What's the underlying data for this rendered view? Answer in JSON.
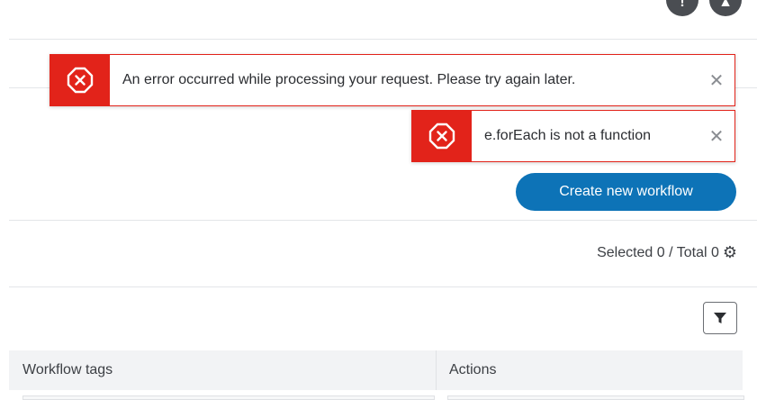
{
  "header": {
    "help_glyph": "!",
    "user_glyph": "▲"
  },
  "toasts": [
    {
      "message": "An error occurred while processing your request. Please try again later.",
      "icon": "error-octagon-icon",
      "close": "✕"
    },
    {
      "message": "e.forEach is not a function",
      "icon": "error-octagon-icon",
      "close": "✕"
    }
  ],
  "actions": {
    "create_label": "Create new workflow"
  },
  "counter": {
    "text": "Selected 0 / Total 0",
    "gear": "⚙"
  },
  "table": {
    "columns": [
      "Workflow tags",
      "Actions"
    ]
  },
  "colors": {
    "error": "#e2231a",
    "primary": "#0d73b7"
  }
}
